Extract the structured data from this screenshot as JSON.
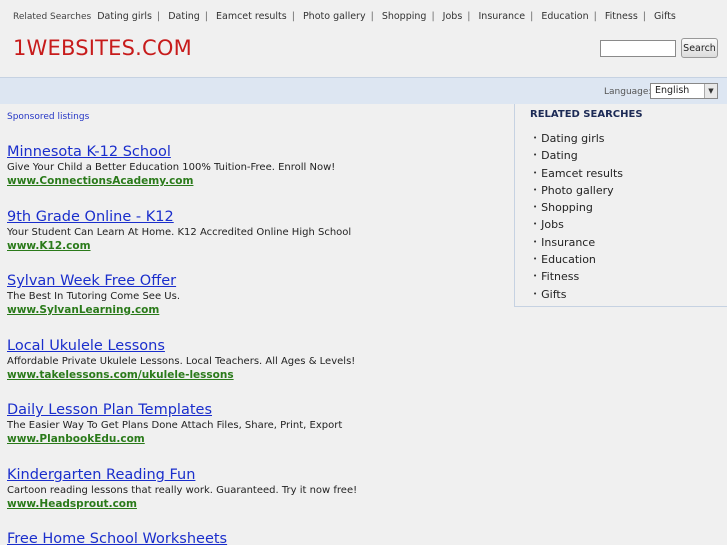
{
  "topnav": {
    "label": "Related Searches",
    "links": [
      "Dating girls",
      "Dating",
      "Eamcet results",
      "Photo gallery",
      "Shopping",
      "Jobs",
      "Insurance",
      "Education",
      "Fitness",
      "Gifts"
    ]
  },
  "header": {
    "logo": "1WEBSITES.COM"
  },
  "search": {
    "button_label": "Search",
    "value": ""
  },
  "language": {
    "label": "Language:",
    "selected": "English"
  },
  "sponsored_label": "Sponsored listings",
  "ads": [
    {
      "title": "Minnesota K-12 School",
      "desc": "Give Your Child a Better Education 100% Tuition-Free. Enroll Now!",
      "url": "www.ConnectionsAcademy.com"
    },
    {
      "title": "9th Grade Online - K12",
      "desc": "Your Student Can Learn At Home. K12 Accredited Online High School",
      "url": "www.K12.com"
    },
    {
      "title": "Sylvan Week Free Offer",
      "desc": "The Best In Tutoring Come See Us.",
      "url": "www.SylvanLearning.com"
    },
    {
      "title": "Local Ukulele Lessons",
      "desc": "Affordable Private Ukulele Lessons. Local Teachers. All Ages & Levels!",
      "url": "www.takelessons.com/ukulele-lessons"
    },
    {
      "title": "Daily Lesson Plan Templates",
      "desc": "The Easier Way To Get Plans Done Attach Files, Share, Print, Export",
      "url": "www.PlanbookEdu.com"
    },
    {
      "title": "Kindergarten Reading Fun",
      "desc": "Cartoon reading lessons that really work. Guaranteed. Try it now free!",
      "url": "www.Headsprout.com"
    },
    {
      "title": "Free Home School Worksheets",
      "desc": "",
      "url": ""
    }
  ],
  "related": {
    "heading": "RELATED SEARCHES",
    "items": [
      "Dating girls",
      "Dating",
      "Eamcet results",
      "Photo gallery",
      "Shopping",
      "Jobs",
      "Insurance",
      "Education",
      "Fitness",
      "Gifts"
    ]
  },
  "colors": {
    "logo": "#c71b1b",
    "ad_title": "#1a2ecc",
    "ad_url": "#2a7a1a",
    "lang_bar": "#dde6f2"
  }
}
